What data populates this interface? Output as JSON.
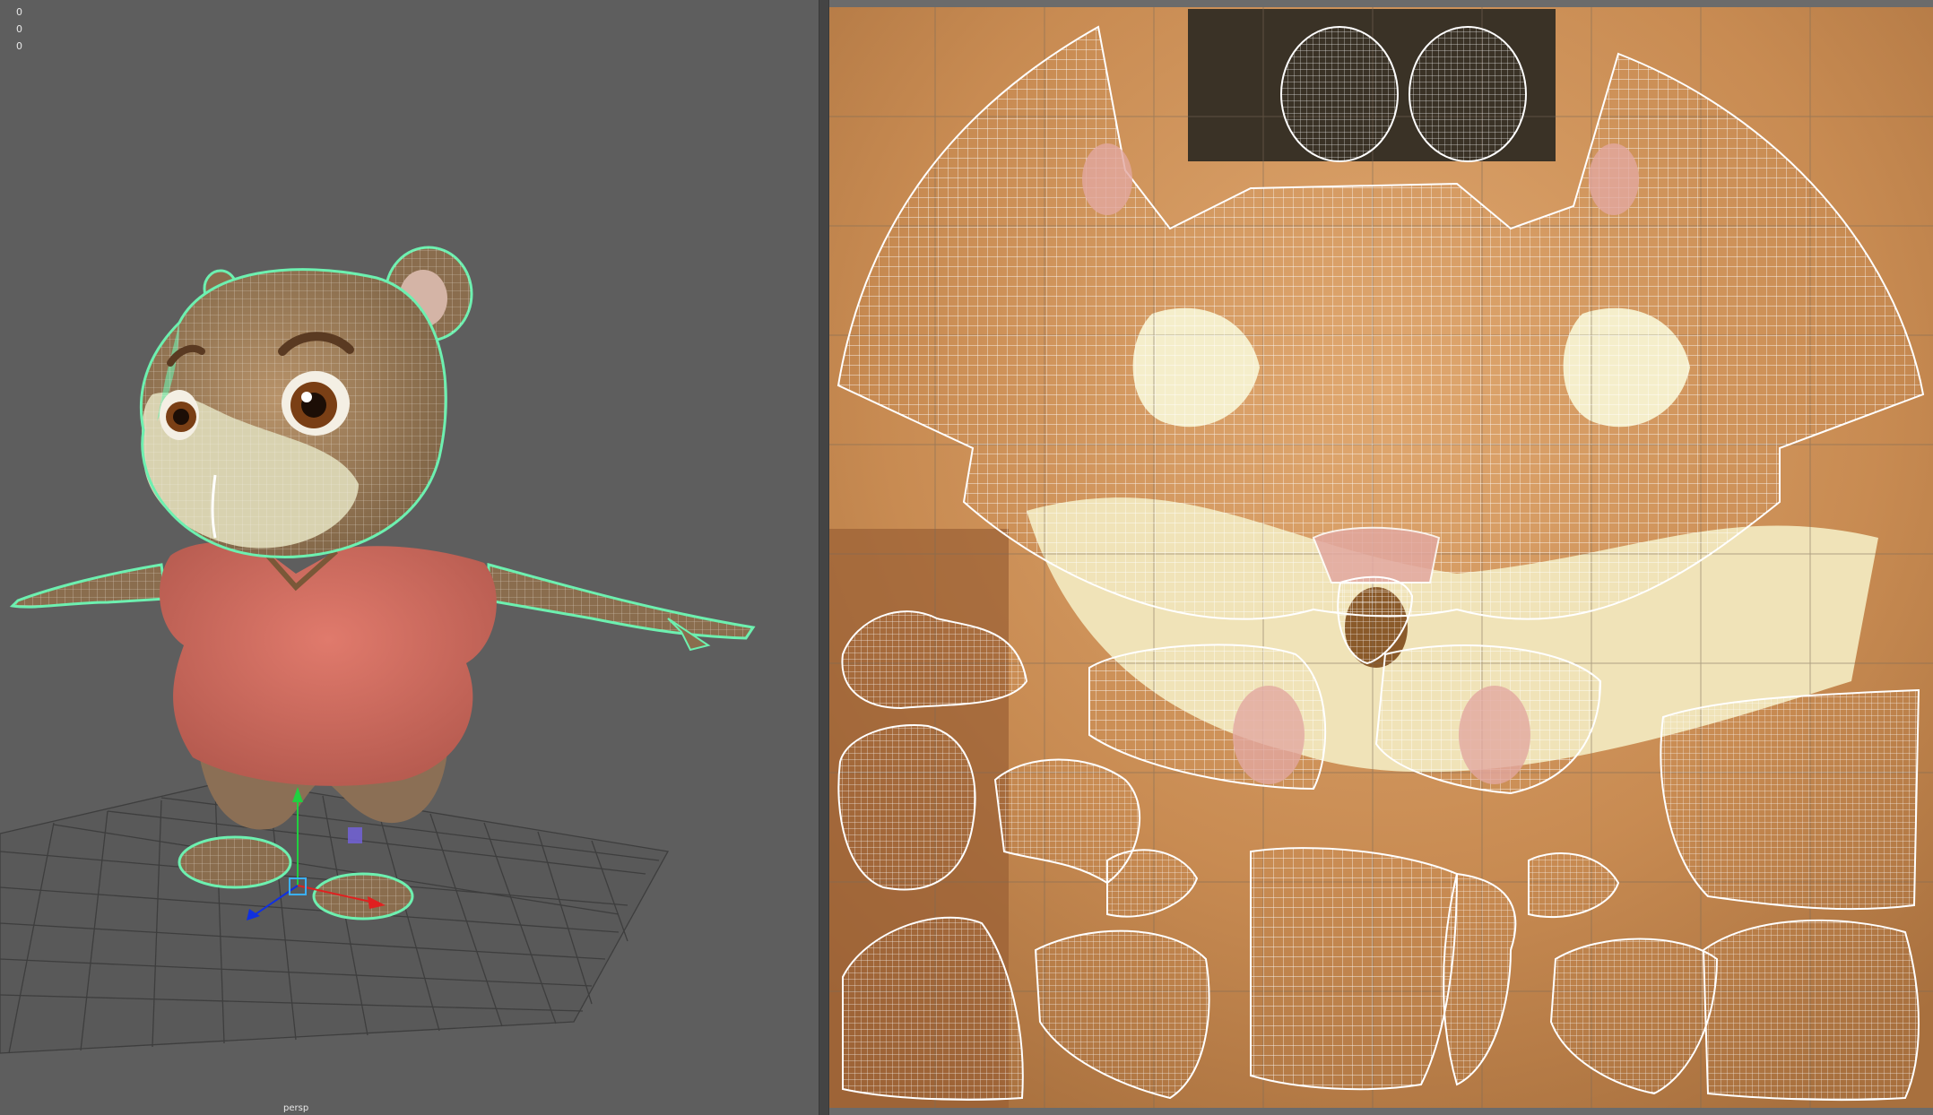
{
  "viewport": {
    "hud_lines": [
      "0",
      "0",
      "0"
    ],
    "camera_label": "persp"
  },
  "colors": {
    "viewport_bg": "#5e5e5e",
    "wire_selected": "#6df0b0",
    "shirt": "#d46a5c",
    "fur": "#a97b54",
    "uv_texture_base": "#c88b52",
    "uv_wire": "#ffffff",
    "axis_x": "#e02020",
    "axis_y": "#20d040",
    "axis_z": "#1030e0"
  },
  "icons": [
    "move-manipulator-icon",
    "axis-gizmo-icon"
  ]
}
